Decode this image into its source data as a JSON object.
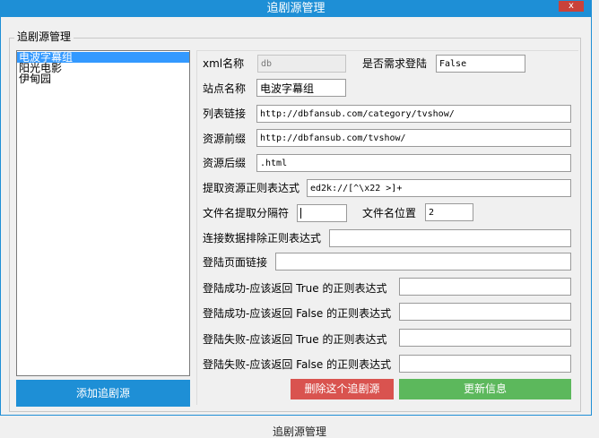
{
  "window": {
    "title": "追剧源管理",
    "close_label": "x"
  },
  "group": {
    "title": "追剧源管理"
  },
  "sources": [
    {
      "label": "电波字幕组",
      "selected": true
    },
    {
      "label": "阳光电影",
      "selected": false
    },
    {
      "label": "伊甸园",
      "selected": false
    }
  ],
  "form": {
    "xml_name": {
      "label": "xml名称",
      "value": "db"
    },
    "need_login": {
      "label": "是否需求登陆",
      "value": "False"
    },
    "site_name": {
      "label": "站点名称",
      "value": "电波字幕组"
    },
    "list_link": {
      "label": "列表链接",
      "value": "http://dbfansub.com/category/tvshow/"
    },
    "res_prefix": {
      "label": "资源前缀",
      "value": "http://dbfansub.com/tvshow/"
    },
    "res_suffix": {
      "label": "资源后缀",
      "value": ".html"
    },
    "extract_regex": {
      "label": "提取资源正则表达式",
      "value": "ed2k://[^\\x22 >]+"
    },
    "filename_sep": {
      "label": "文件名提取分隔符",
      "value": ""
    },
    "filename_pos": {
      "label": "文件名位置",
      "value": "2"
    },
    "exclude_regex": {
      "label": "连接数据排除正则表达式",
      "value": ""
    },
    "login_link": {
      "label": "登陆页面链接",
      "value": ""
    },
    "login_ok_true": {
      "label": "登陆成功-应该返回 True 的正则表达式",
      "value": ""
    },
    "login_ok_false": {
      "label": "登陆成功-应该返回 False 的正则表达式",
      "value": ""
    },
    "login_fail_true": {
      "label": "登陆失败-应该返回 True 的正则表达式",
      "value": ""
    },
    "login_fail_false": {
      "label": "登陆失败-应该返回 False 的正则表达式",
      "value": ""
    }
  },
  "buttons": {
    "add": "添加追剧源",
    "delete": "删除这个追剧源",
    "update": "更新信息"
  },
  "taskbar": {
    "label": "追剧源管理"
  },
  "colors": {
    "accent": "#1e8fd6",
    "danger": "#d9534f",
    "success": "#5cb85c",
    "selection": "#3399ff"
  }
}
